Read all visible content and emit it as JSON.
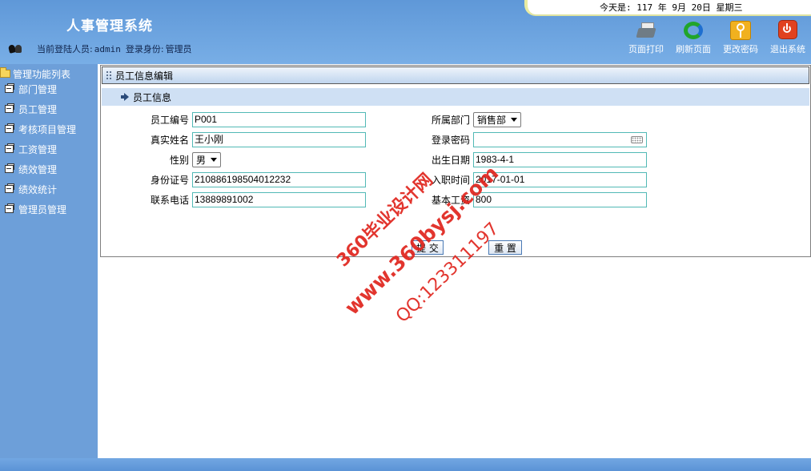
{
  "header": {
    "app_title": "人事管理系统",
    "user_label": "当前登陆人员:",
    "username": "admin",
    "role_label": "登录身份:",
    "role": "管理员",
    "date_text": "今天是: 117 年 9月 20日 星期三",
    "toolbar": [
      {
        "label": "页面打印",
        "icon": "printer-icon"
      },
      {
        "label": "刷新页面",
        "icon": "refresh-icon"
      },
      {
        "label": "更改密码",
        "icon": "key-icon"
      },
      {
        "label": "退出系统",
        "icon": "power-icon"
      }
    ]
  },
  "sidebar": {
    "title": "管理功能列表",
    "items": [
      {
        "label": "部门管理"
      },
      {
        "label": "员工管理"
      },
      {
        "label": "考核项目管理"
      },
      {
        "label": "工资管理"
      },
      {
        "label": "绩效管理"
      },
      {
        "label": "绩效统计"
      },
      {
        "label": "管理员管理"
      }
    ]
  },
  "panel": {
    "title": "员工信息编辑",
    "section_title": "员工信息",
    "fields": {
      "emp_no": {
        "label": "员工编号",
        "value": "P001"
      },
      "real_name": {
        "label": "真实姓名",
        "value": "王小刚"
      },
      "gender": {
        "label": "性别",
        "value": "男"
      },
      "id_card": {
        "label": "身份证号",
        "value": "210886198504012232"
      },
      "phone": {
        "label": "联系电话",
        "value": "13889891002"
      },
      "department": {
        "label": "所属部门",
        "value": "销售部"
      },
      "password": {
        "label": "登录密码",
        "value": ""
      },
      "birth_date": {
        "label": "出生日期",
        "value": "1983-4-1"
      },
      "hire_date": {
        "label": "入职时间",
        "value": "2017-01-01"
      },
      "base_salary": {
        "label": "基本工资",
        "value": "800"
      }
    },
    "submit_label": "提 交",
    "reset_label": "重 置"
  },
  "watermark": {
    "line1": "360毕业设计网",
    "line2": "www.360bysj.com",
    "line3": "QQ:123311197",
    "color": "#e0241d"
  }
}
